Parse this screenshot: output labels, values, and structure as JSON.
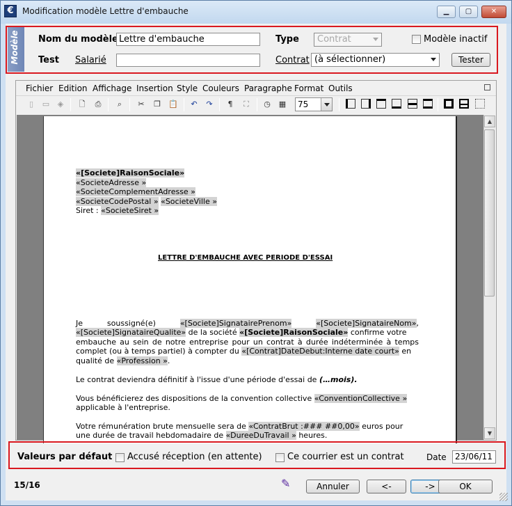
{
  "window": {
    "title": "Modification modèle Lettre d'embauche",
    "app_icon": "€"
  },
  "modele": {
    "side_label": "Modèle",
    "nom_label": "Nom du modèle",
    "nom_value": "Lettre d'embauche",
    "type_label": "Type",
    "type_value": "Contrat",
    "inactif_label": "Modèle inactif",
    "test_label": "Test",
    "salarie_label": "Salarié",
    "salarie_value": "",
    "contrat_label": "Contrat",
    "contrat_value": "(à sélectionner)",
    "tester_label": "Tester"
  },
  "menu": [
    "Fichier",
    "Edition",
    "Affichage",
    "Insertion",
    "Style",
    "Couleurs",
    "Paragraphe",
    "Format",
    "Outils"
  ],
  "toolbar": {
    "zoom": "75"
  },
  "document": {
    "header": [
      "«[Societe]RaisonSociale»",
      "«SocieteAdresse »",
      "«SocieteComplementAdresse »",
      "«SocieteCodePostal »",
      "«SocieteVille »",
      "Siret : ",
      "«SocieteSiret »"
    ],
    "title": "LETTRE D'EMBAUCHE AVEC PERIODE D'ESSAI",
    "p1": {
      "je": "Je",
      "soussigne": "soussigné(e)",
      "prenom": "«[Societe]SignatairePrenom»",
      "nom": "«[Societe]SignataireNom»",
      "qualite": "«[Societe]SignataireQualite»",
      "de_la_societe": " de la société ",
      "raison": "«[Societe]RaisonSociale»",
      "confirme": " confirme votre",
      "l3": "embauche au sein de notre entreprise pour un contrat à durée indéterminée à temps",
      "l4a": "complet (ou à temps partiel) à compter du ",
      "datedebut": "«[Contrat]DateDebut:Interne date court»",
      "en": " en",
      "l5a": "qualité de ",
      "profession": "«Profession »",
      "l5b": "."
    },
    "p2a": "Le contrat deviendra définitif à l'issue d'une période d'essai de ",
    "p2b": "(…mois).",
    "p3a": "Vous bénéficierez des dispositions de la convention collective ",
    "convention": "«ConventionCollective »",
    "p3b": "applicable à l'entreprise.",
    "p4a": "Votre rémunération brute mensuelle sera de ",
    "brut": "«ContratBrut :### ##0,00»",
    "p4b": " euros pour",
    "p4c": "une durée de travail hebdomadaire de ",
    "duree": "«DureeDuTravail »",
    "p4d": " heures."
  },
  "defaults": {
    "label": "Valeurs par défaut",
    "accuse_label": "Accusé réception (en attente)",
    "contrat_label": "Ce courrier est un contrat",
    "date_label": "Date",
    "date_value": "23/06/11"
  },
  "status": {
    "page": "15/16",
    "annuler": "Annuler",
    "prev": "<-",
    "next": "->",
    "ok": "OK"
  }
}
